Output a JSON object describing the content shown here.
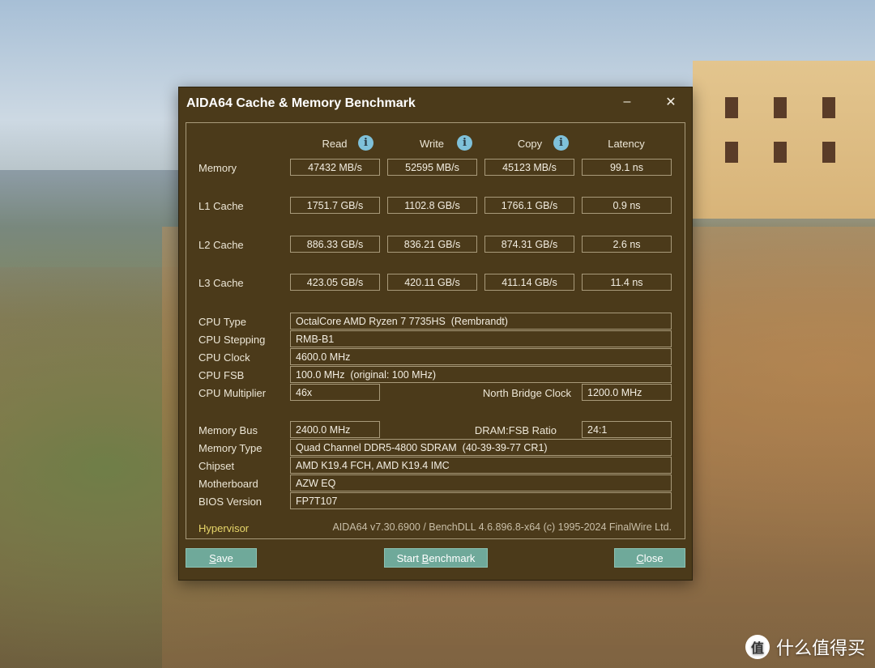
{
  "window": {
    "title": "AIDA64 Cache & Memory Benchmark",
    "minimize": "–",
    "close": "✕"
  },
  "columns": [
    "Read",
    "Write",
    "Copy",
    "Latency"
  ],
  "bench_rows": [
    {
      "label": "Memory",
      "read": "47432 MB/s",
      "write": "52595 MB/s",
      "copy": "45123 MB/s",
      "latency": "99.1 ns"
    },
    {
      "label": "L1 Cache",
      "read": "1751.7 GB/s",
      "write": "1102.8 GB/s",
      "copy": "1766.1 GB/s",
      "latency": "0.9 ns"
    },
    {
      "label": "L2 Cache",
      "read": "886.33 GB/s",
      "write": "836.21 GB/s",
      "copy": "874.31 GB/s",
      "latency": "2.6 ns"
    },
    {
      "label": "L3 Cache",
      "read": "423.05 GB/s",
      "write": "420.11 GB/s",
      "copy": "411.14 GB/s",
      "latency": "11.4 ns"
    }
  ],
  "cpu": {
    "type_label": "CPU Type",
    "type": "OctalCore AMD Ryzen 7 7735HS  (Rembrandt)",
    "stepping_label": "CPU Stepping",
    "stepping": "RMB-B1",
    "clock_label": "CPU Clock",
    "clock": "4600.0 MHz",
    "fsb_label": "CPU FSB",
    "fsb": "100.0 MHz  (original: 100 MHz)",
    "multiplier_label": "CPU Multiplier",
    "multiplier": "46x",
    "nb_clock_label": "North Bridge Clock",
    "nb_clock": "1200.0 MHz"
  },
  "memory": {
    "bus_label": "Memory Bus",
    "bus": "2400.0 MHz",
    "ratio_label": "DRAM:FSB Ratio",
    "ratio": "24:1",
    "type_label": "Memory Type",
    "type": "Quad Channel DDR5-4800 SDRAM  (40-39-39-77 CR1)",
    "chipset_label": "Chipset",
    "chipset": "AMD K19.4 FCH, AMD K19.4 IMC",
    "motherboard_label": "Motherboard",
    "motherboard": "AZW EQ",
    "bios_label": "BIOS Version",
    "bios": "FP7T107"
  },
  "footer": {
    "hypervisor": "Hypervisor",
    "version": "AIDA64 v7.30.6900 / BenchDLL 4.6.896.8-x64  (c) 1995-2024 FinalWire Ltd."
  },
  "buttons": {
    "save_u": "S",
    "save_rest": "ave",
    "start_pre": "Start ",
    "start_u": "B",
    "start_rest": "enchmark",
    "close_u": "C",
    "close_rest": "lose"
  },
  "watermark": {
    "icon": "值",
    "text": "什么值得买"
  },
  "colors": {
    "window_bg": "#4b3a1a",
    "button_bg": "#6fa99a",
    "info_icon": "#7fc1da",
    "hypervisor": "#e7d66a"
  }
}
